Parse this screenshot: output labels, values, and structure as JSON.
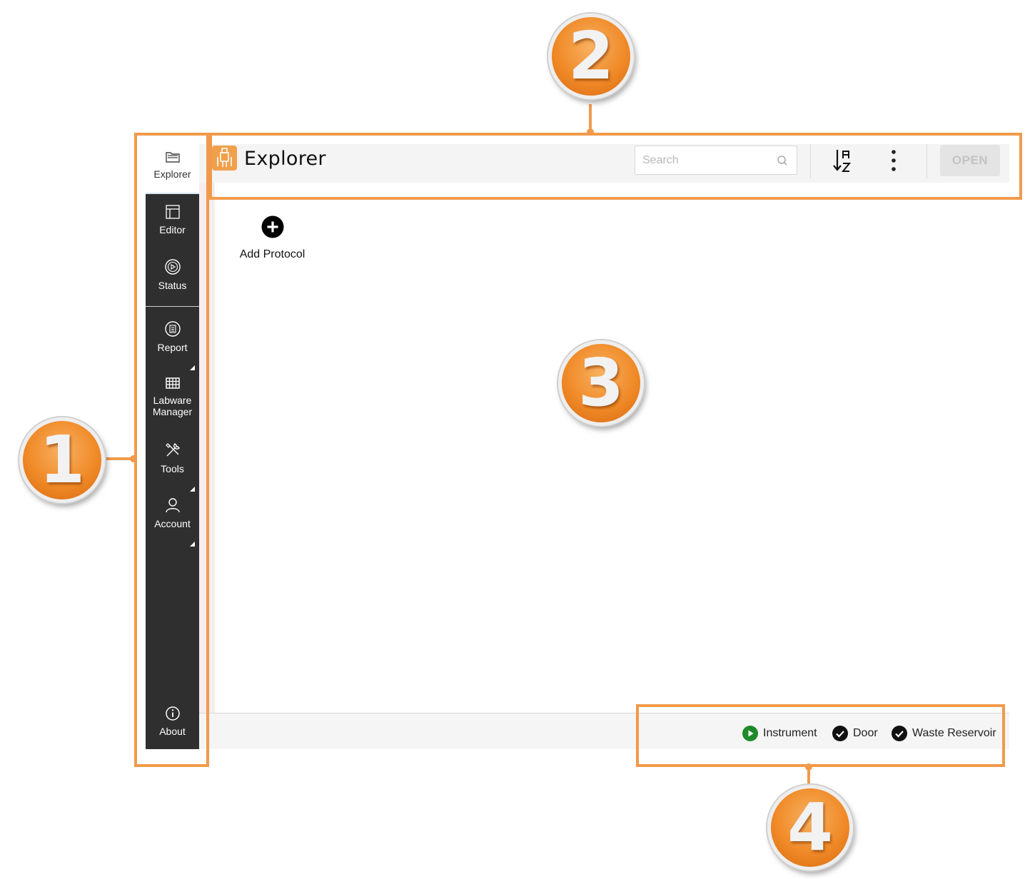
{
  "sidebar": {
    "items": [
      {
        "label": "Explorer",
        "icon": "folder-icon",
        "active": true
      },
      {
        "label": "Editor",
        "icon": "editor-icon"
      },
      {
        "label": "Status",
        "icon": "play-circle-icon"
      },
      {
        "label": "Report",
        "icon": "clipboard-icon",
        "has_submenu": true
      },
      {
        "label": "Labware\nManager",
        "icon": "grid-icon"
      },
      {
        "label": "Tools",
        "icon": "tools-icon",
        "has_submenu": true
      },
      {
        "label": "Account",
        "icon": "user-icon",
        "has_submenu": true
      },
      {
        "label": "About",
        "icon": "info-icon"
      }
    ]
  },
  "header": {
    "title": "Explorer",
    "search_placeholder": "Search",
    "sort_icon": "sort-az-icon",
    "more_icon": "more-vertical-icon",
    "open_label": "OPEN"
  },
  "main": {
    "add_protocol_label": "Add Protocol"
  },
  "footer": {
    "statuses": [
      {
        "label": "Instrument",
        "icon": "play-circle-icon",
        "color": "#1e8a2a"
      },
      {
        "label": "Door",
        "icon": "check-circle-icon",
        "color": "#111111"
      },
      {
        "label": "Waste Reservoir",
        "icon": "check-circle-icon",
        "color": "#111111"
      }
    ]
  },
  "annotations": {
    "color": "#f19a4b",
    "badges": [
      "1",
      "2",
      "3",
      "4"
    ]
  }
}
